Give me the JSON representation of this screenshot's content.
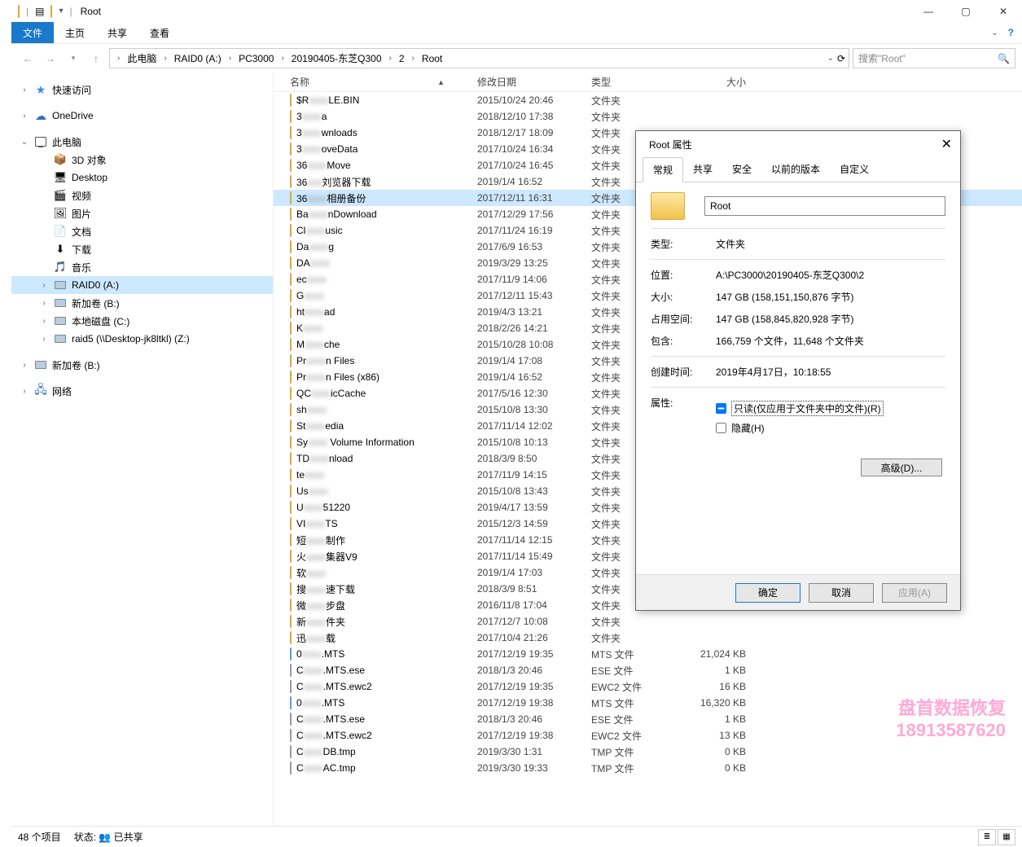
{
  "window": {
    "title": "Root"
  },
  "ribbon": {
    "file": "文件",
    "home": "主页",
    "share": "共享",
    "view": "查看"
  },
  "breadcrumbs": [
    "此电脑",
    "RAID0 (A:)",
    "PC3000",
    "20190405-东芝Q300",
    "2",
    "Root"
  ],
  "search_placeholder": "搜索\"Root\"",
  "columns": {
    "name": "名称",
    "date": "修改日期",
    "type": "类型",
    "size": "大小"
  },
  "tree": {
    "quick": "快速访问",
    "onedrive": "OneDrive",
    "thispc": "此电脑",
    "thispc_items": [
      "3D 对象",
      "Desktop",
      "视频",
      "图片",
      "文档",
      "下载",
      "音乐",
      "RAID0 (A:)",
      "新加卷 (B:)",
      "本地磁盘 (C:)",
      "raid5 (\\\\Desktop-jk8ltkl) (Z:)"
    ],
    "newvol": "新加卷 (B:)",
    "network": "网络"
  },
  "type_labels": {
    "folder": "文件夹",
    "mts": "MTS 文件",
    "ese": "ESE 文件",
    "ewc2": "EWC2 文件",
    "tmp": "TMP 文件"
  },
  "files": [
    {
      "kind": "folder",
      "pre": "$R",
      "blur": "xxxx",
      "post": "LE.BIN",
      "date": "2015/10/24 20:46",
      "type": "folder",
      "size": ""
    },
    {
      "kind": "folder",
      "pre": "3",
      "blur": "xxxx",
      "post": "a",
      "date": "2018/12/10 17:38",
      "type": "folder",
      "size": ""
    },
    {
      "kind": "folder",
      "pre": "3",
      "blur": "xxxx",
      "post": "wnloads",
      "date": "2018/12/17 18:09",
      "type": "folder",
      "size": ""
    },
    {
      "kind": "folder",
      "pre": "3",
      "blur": "xxxx",
      "post": "oveData",
      "date": "2017/10/24 16:34",
      "type": "folder",
      "size": ""
    },
    {
      "kind": "folder",
      "pre": "36",
      "blur": "xxxx",
      "post": "Move",
      "date": "2017/10/24 16:45",
      "type": "folder",
      "size": ""
    },
    {
      "kind": "folder",
      "pre": "36",
      "blur": "xxx",
      "post": "刘览器下载",
      "date": "2019/1/4 16:52",
      "type": "folder",
      "size": ""
    },
    {
      "kind": "folder",
      "pre": "36",
      "blur": "xxxx",
      "post": "相册备份",
      "date": "2017/12/11 16:31",
      "type": "folder",
      "size": "",
      "sel": true
    },
    {
      "kind": "folder",
      "pre": "Ba",
      "blur": "xxxx",
      "post": "nDownload",
      "date": "2017/12/29 17:56",
      "type": "folder",
      "size": ""
    },
    {
      "kind": "folder",
      "pre": "Cl",
      "blur": "xxxx",
      "post": "usic",
      "date": "2017/11/24 16:19",
      "type": "folder",
      "size": ""
    },
    {
      "kind": "folder",
      "pre": "Da",
      "blur": "xxxx",
      "post": "g",
      "date": "2017/6/9 16:53",
      "type": "folder",
      "size": ""
    },
    {
      "kind": "folder",
      "pre": "DA",
      "blur": "xxxx",
      "post": "",
      "date": "2019/3/29 13:25",
      "type": "folder",
      "size": ""
    },
    {
      "kind": "folder",
      "pre": "ec",
      "blur": "xxxx",
      "post": "",
      "date": "2017/11/9 14:06",
      "type": "folder",
      "size": ""
    },
    {
      "kind": "folder",
      "pre": "G",
      "blur": "xxxx",
      "post": "",
      "date": "2017/12/11 15:43",
      "type": "folder",
      "size": ""
    },
    {
      "kind": "folder",
      "pre": "ht",
      "blur": "xxxx",
      "post": "ad",
      "date": "2019/4/3 13:21",
      "type": "folder",
      "size": ""
    },
    {
      "kind": "folder",
      "pre": "K",
      "blur": "xxxx",
      "post": "",
      "date": "2018/2/26 14:21",
      "type": "folder",
      "size": ""
    },
    {
      "kind": "folder",
      "pre": "M",
      "blur": "xxxx",
      "post": "che",
      "date": "2015/10/28 10:08",
      "type": "folder",
      "size": ""
    },
    {
      "kind": "folder",
      "pre": "Pr",
      "blur": "xxxx",
      "post": "n Files",
      "date": "2019/1/4 17:08",
      "type": "folder",
      "size": ""
    },
    {
      "kind": "folder",
      "pre": "Pr",
      "blur": "xxxx",
      "post": "n Files (x86)",
      "date": "2019/1/4 16:52",
      "type": "folder",
      "size": ""
    },
    {
      "kind": "folder",
      "pre": "QC",
      "blur": "xxxx",
      "post": "icCache",
      "date": "2017/5/16 12:30",
      "type": "folder",
      "size": ""
    },
    {
      "kind": "folder",
      "pre": "sh",
      "blur": "xxxx",
      "post": "",
      "date": "2015/10/8 13:30",
      "type": "folder",
      "size": ""
    },
    {
      "kind": "folder",
      "pre": "St",
      "blur": "xxxx",
      "post": "edia",
      "date": "2017/11/14 12:02",
      "type": "folder",
      "size": ""
    },
    {
      "kind": "folder",
      "pre": "Sy",
      "blur": "xxxx",
      "post": " Volume Information",
      "date": "2015/10/8 10:13",
      "type": "folder",
      "size": ""
    },
    {
      "kind": "folder",
      "pre": "TD",
      "blur": "xxxx",
      "post": "nload",
      "date": "2018/3/9 8:50",
      "type": "folder",
      "size": ""
    },
    {
      "kind": "folder",
      "pre": "te",
      "blur": "xxxx",
      "post": "",
      "date": "2017/11/9 14:15",
      "type": "folder",
      "size": ""
    },
    {
      "kind": "folder",
      "pre": "Us",
      "blur": "xxxx",
      "post": "",
      "date": "2015/10/8 13:43",
      "type": "folder",
      "size": ""
    },
    {
      "kind": "folder",
      "pre": "U",
      "blur": "xxxx",
      "post": "51220",
      "date": "2019/4/17 13:59",
      "type": "folder",
      "size": ""
    },
    {
      "kind": "folder",
      "pre": "VI",
      "blur": "xxxx",
      "post": "TS",
      "date": "2015/12/3 14:59",
      "type": "folder",
      "size": ""
    },
    {
      "kind": "folder",
      "pre": "短",
      "blur": "xxxx",
      "post": "制作",
      "date": "2017/11/14 12:15",
      "type": "folder",
      "size": ""
    },
    {
      "kind": "folder",
      "pre": "火",
      "blur": "xxxx",
      "post": "集器V9",
      "date": "2017/11/14 15:49",
      "type": "folder",
      "size": ""
    },
    {
      "kind": "folder",
      "pre": "软",
      "blur": "xxxx",
      "post": "",
      "date": "2019/1/4 17:03",
      "type": "folder",
      "size": ""
    },
    {
      "kind": "folder",
      "pre": "搜",
      "blur": "xxxx",
      "post": "速下载",
      "date": "2018/3/9 8:51",
      "type": "folder",
      "size": ""
    },
    {
      "kind": "folder",
      "pre": "微",
      "blur": "xxxx",
      "post": "步盘",
      "date": "2016/11/8 17:04",
      "type": "folder",
      "size": ""
    },
    {
      "kind": "folder",
      "pre": "新",
      "blur": "xxxx",
      "post": "件夹",
      "date": "2017/12/7 10:08",
      "type": "folder",
      "size": ""
    },
    {
      "kind": "folder",
      "pre": "迅",
      "blur": "xxxx",
      "post": "载",
      "date": "2017/10/4 21:26",
      "type": "folder",
      "size": ""
    },
    {
      "kind": "mts",
      "pre": "0",
      "blur": "xxxx",
      "post": ".MTS",
      "date": "2017/12/19 19:35",
      "type": "mts",
      "size": "21,024 KB"
    },
    {
      "kind": "file",
      "pre": "C",
      "blur": "xxxx",
      "post": ".MTS.ese",
      "date": "2018/1/3 20:46",
      "type": "ese",
      "size": "1 KB"
    },
    {
      "kind": "file",
      "pre": "C",
      "blur": "xxxx",
      "post": ".MTS.ewc2",
      "date": "2017/12/19 19:35",
      "type": "ewc2",
      "size": "16 KB"
    },
    {
      "kind": "mts",
      "pre": "0",
      "blur": "xxxx",
      "post": ".MTS",
      "date": "2017/12/19 19:38",
      "type": "mts",
      "size": "16,320 KB"
    },
    {
      "kind": "file",
      "pre": "C",
      "blur": "xxxx",
      "post": ".MTS.ese",
      "date": "2018/1/3 20:46",
      "type": "ese",
      "size": "1 KB"
    },
    {
      "kind": "file",
      "pre": "C",
      "blur": "xxxx",
      "post": ".MTS.ewc2",
      "date": "2017/12/19 19:38",
      "type": "ewc2",
      "size": "13 KB"
    },
    {
      "kind": "file",
      "pre": "C",
      "blur": "xxxx",
      "post": "DB.tmp",
      "date": "2019/3/30 1:31",
      "type": "tmp",
      "size": "0 KB"
    },
    {
      "kind": "file",
      "pre": "C",
      "blur": "xxxx",
      "post": "AC.tmp",
      "date": "2019/3/30 19:33",
      "type": "tmp",
      "size": "0 KB"
    }
  ],
  "status": {
    "items": "48 个项目",
    "state_lbl": "状态:",
    "state_val": "已共享"
  },
  "dialog": {
    "title": "Root 属性",
    "tabs": [
      "常规",
      "共享",
      "安全",
      "以前的版本",
      "自定义"
    ],
    "name_value": "Root",
    "fields": {
      "type_k": "类型:",
      "type_v": "文件夹",
      "loc_k": "位置:",
      "loc_v": "A:\\PC3000\\20190405-东芝Q300\\2",
      "size_k": "大小:",
      "size_v": "147 GB (158,151,150,876 字节)",
      "disk_k": "占用空间:",
      "disk_v": "147 GB (158,845,820,928 字节)",
      "contains_k": "包含:",
      "contains_v": "166,759 个文件，11,648 个文件夹",
      "created_k": "创建时间:",
      "created_v": "2019年4月17日，10:18:55",
      "attr_k": "属性:",
      "readonly": "只读(仅应用于文件夹中的文件)(R)",
      "hidden": "隐藏(H)",
      "advanced": "高级(D)..."
    },
    "buttons": {
      "ok": "确定",
      "cancel": "取消",
      "apply": "应用(A)"
    }
  },
  "watermark": {
    "l1": "盘首数据恢复",
    "l2": "18913587620"
  }
}
